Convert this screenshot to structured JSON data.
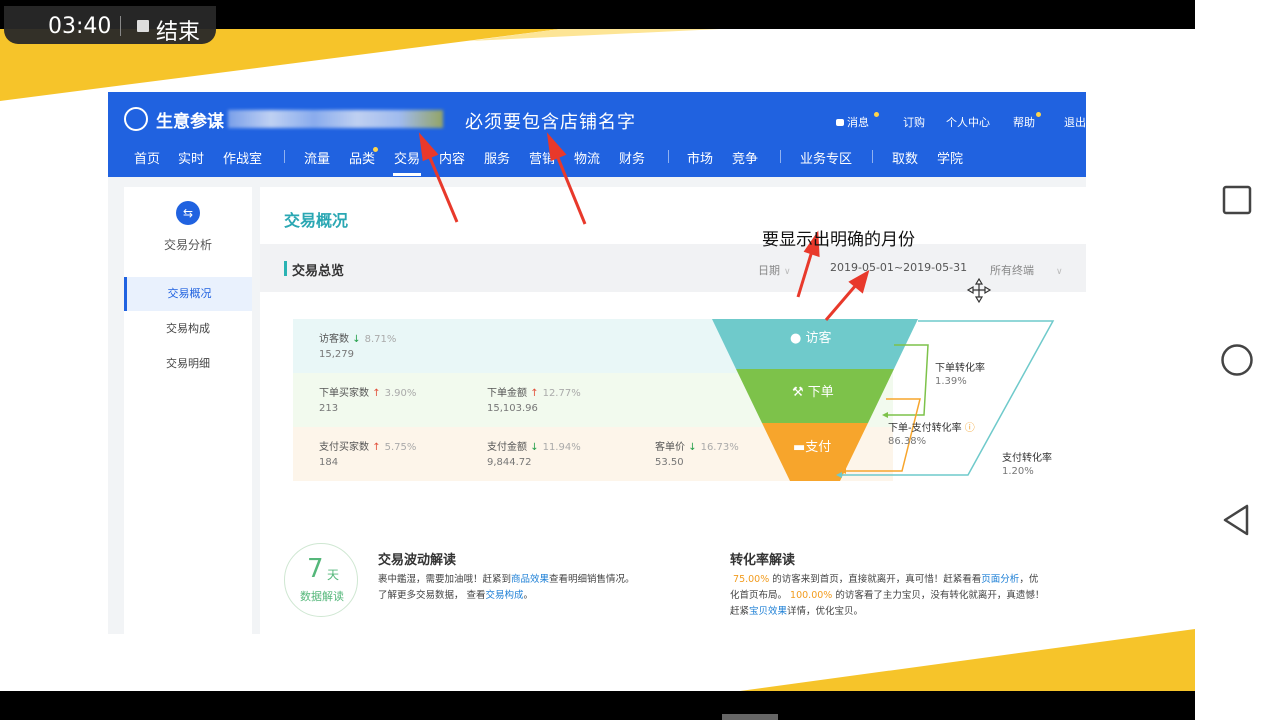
{
  "status": {
    "time": "03:40",
    "end_label": "结束"
  },
  "header": {
    "brand": "生意参谋",
    "annotation": "必须要包含店铺名字",
    "links": {
      "messages": "消息",
      "subscribe": "订购",
      "personal_center": "个人中心",
      "help": "帮助",
      "logout": "退出"
    }
  },
  "nav": {
    "items": [
      {
        "label": "首页"
      },
      {
        "label": "实时"
      },
      {
        "label": "作战室"
      },
      {
        "label": "流量"
      },
      {
        "label": "品类"
      },
      {
        "label": "交易"
      },
      {
        "label": "内容"
      },
      {
        "label": "服务"
      },
      {
        "label": "营销"
      },
      {
        "label": "物流"
      },
      {
        "label": "财务"
      },
      {
        "label": "市场"
      },
      {
        "label": "竞争"
      },
      {
        "label": "业务专区"
      },
      {
        "label": "取数"
      },
      {
        "label": "学院"
      }
    ],
    "active": "交易"
  },
  "sidebar": {
    "title": "交易分析",
    "items": [
      {
        "label": "交易概况"
      },
      {
        "label": "交易构成"
      },
      {
        "label": "交易明细"
      }
    ],
    "active_index": 0
  },
  "main": {
    "title": "交易概况",
    "section_title": "交易总览",
    "date_label": "日期",
    "date_range": "2019-05-01~2019-05-31",
    "terminal_label": "所有终端",
    "annotation_month": "要显示出明确的月份"
  },
  "metrics": {
    "visitors": {
      "label": "访客数",
      "trend": "down",
      "pct": "8.71%",
      "value": "15,279"
    },
    "order_buyers": {
      "label": "下单买家数",
      "trend": "up",
      "pct": "3.90%",
      "value": "213"
    },
    "order_amount": {
      "label": "下单金额",
      "trend": "up",
      "pct": "12.77%",
      "value": "15,103.96"
    },
    "pay_buyers": {
      "label": "支付买家数",
      "trend": "up",
      "pct": "5.75%",
      "value": "184"
    },
    "pay_amount": {
      "label": "支付金额",
      "trend": "down",
      "pct": "11.94%",
      "value": "9,844.72"
    },
    "unit_price": {
      "label": "客单价",
      "trend": "down",
      "pct": "16.73%",
      "value": "53.50"
    }
  },
  "funnel": {
    "stages": [
      {
        "label": "访客"
      },
      {
        "label": "下单"
      },
      {
        "label": "支付"
      }
    ],
    "colors": {
      "visitor": "#6fcacb",
      "order": "#7dc24a",
      "pay": "#f7a52c"
    },
    "rates": {
      "order_conv": {
        "label": "下单转化率",
        "value": "1.39%"
      },
      "order_pay_conv": {
        "label": "下单-支付转化率",
        "value": "86.38%"
      },
      "pay_conv": {
        "label": "支付转化率",
        "value": "1.20%"
      }
    }
  },
  "insights": {
    "badge_num": "7",
    "badge_unit": "天",
    "badge_text": "数据解读",
    "wave": {
      "title": "交易波动解读",
      "line1_a": "裹中鑑湿，需要加油哦！赶紧到",
      "line1_link": "商品效果",
      "line1_b": "查看明细销售情况。",
      "line2_a": "了解更多交易数据， 查看",
      "line2_link": "交易构成",
      "line2_b": "。"
    },
    "conv": {
      "title": "转化率解读",
      "p1": "75.00%",
      "t1": " 的访客来到首页，直接就离开，真可惜！赶紧看看",
      "link1": "页面分析",
      "t2": "，优",
      "t3": "化首页布局。",
      "p2": "100.00%",
      "t4": " 的访客看了主力宝贝，没有转化就离开，真遗憾！",
      "t5": "赶紧",
      "link2": "宝贝效果",
      "t6": "详情，优化宝贝。"
    }
  },
  "colors": {
    "brand_blue": "#2062e0",
    "accent_yellow": "#f6c42a",
    "teal_title": "#2aa7b3"
  }
}
